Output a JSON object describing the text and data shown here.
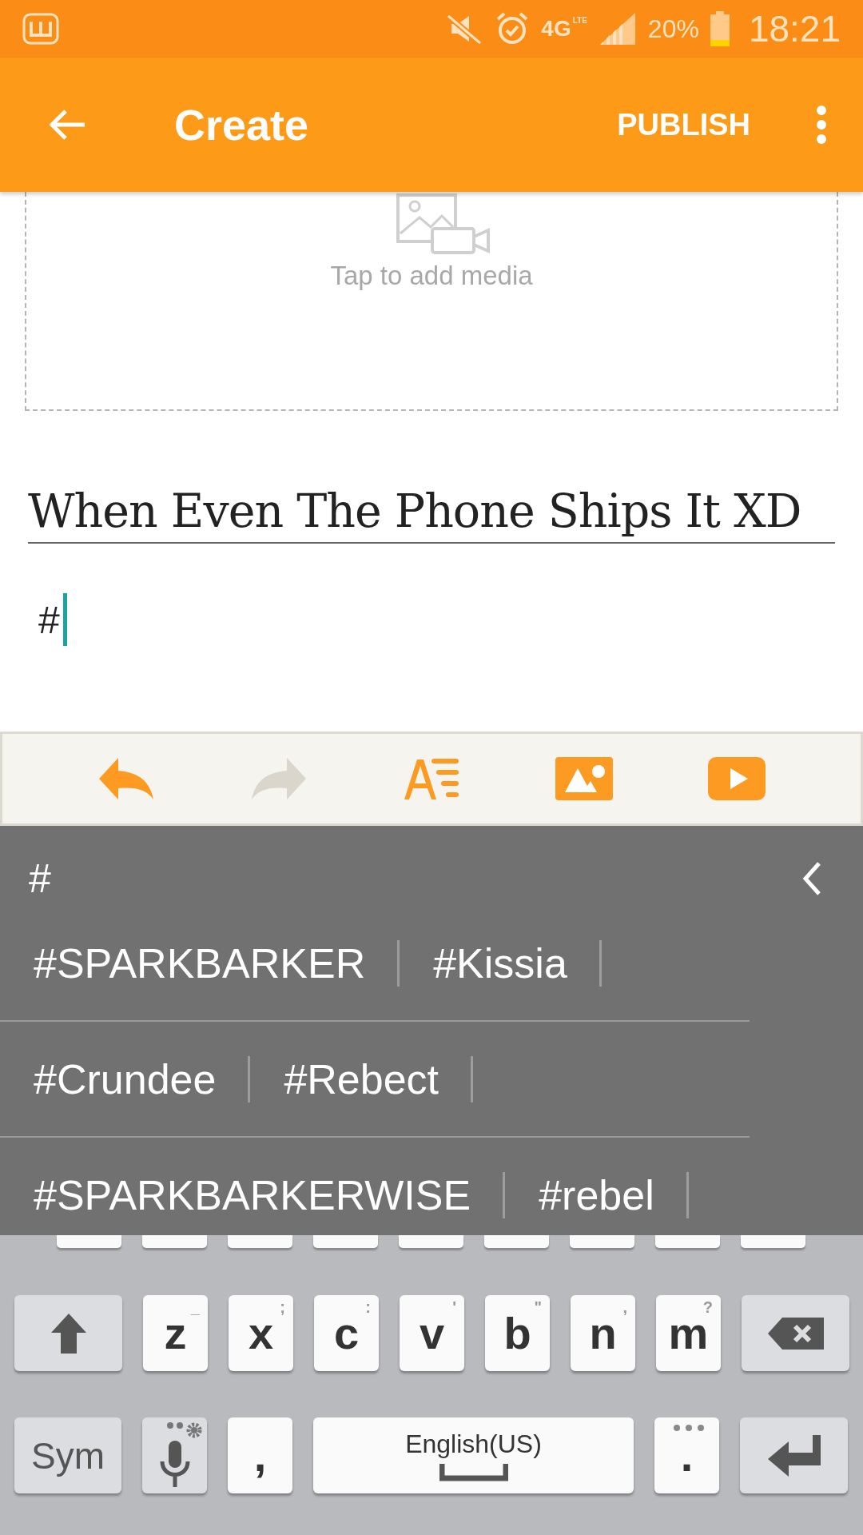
{
  "status_bar": {
    "network": "4G",
    "network_sub": "LTE",
    "battery": "20%",
    "time": "18:21"
  },
  "app_bar": {
    "title": "Create",
    "action": "PUBLISH"
  },
  "media": {
    "placeholder": "Tap to add media"
  },
  "title_field": {
    "value": "When Even The Phone Ships It XD"
  },
  "body_field": {
    "value": "#"
  },
  "toolbar": [
    {
      "kind": "undo",
      "disabled": false
    },
    {
      "kind": "redo",
      "disabled": true
    },
    {
      "kind": "format",
      "disabled": false
    },
    {
      "kind": "image",
      "disabled": false
    },
    {
      "kind": "video",
      "disabled": false
    }
  ],
  "hashtag_panel": {
    "query": "#",
    "rows": [
      [
        "#SPARKBARKER",
        "#Kissia"
      ],
      [
        "#Crundee",
        "#Rebect"
      ],
      [
        "#SPARKBARKERWISE",
        "#rebel"
      ]
    ]
  },
  "keyboard": {
    "letter_row": [
      {
        "kind": "shift"
      },
      {
        "kind": "letter",
        "label": "z",
        "hint": "_"
      },
      {
        "kind": "letter",
        "label": "x",
        "hint": ";"
      },
      {
        "kind": "letter",
        "label": "c",
        "hint": ":"
      },
      {
        "kind": "letter",
        "label": "v",
        "hint": "'"
      },
      {
        "kind": "letter",
        "label": "b",
        "hint": "\""
      },
      {
        "kind": "letter",
        "label": "n",
        "hint": ","
      },
      {
        "kind": "letter",
        "label": "m",
        "hint": "?"
      },
      {
        "kind": "backspace"
      }
    ],
    "bottom_row": [
      {
        "kind": "sym",
        "label": "Sym"
      },
      {
        "kind": "mic"
      },
      {
        "kind": "letter",
        "label": ","
      },
      {
        "kind": "space",
        "label": "English(US)"
      },
      {
        "kind": "period",
        "label": "."
      },
      {
        "kind": "enter"
      }
    ]
  }
}
